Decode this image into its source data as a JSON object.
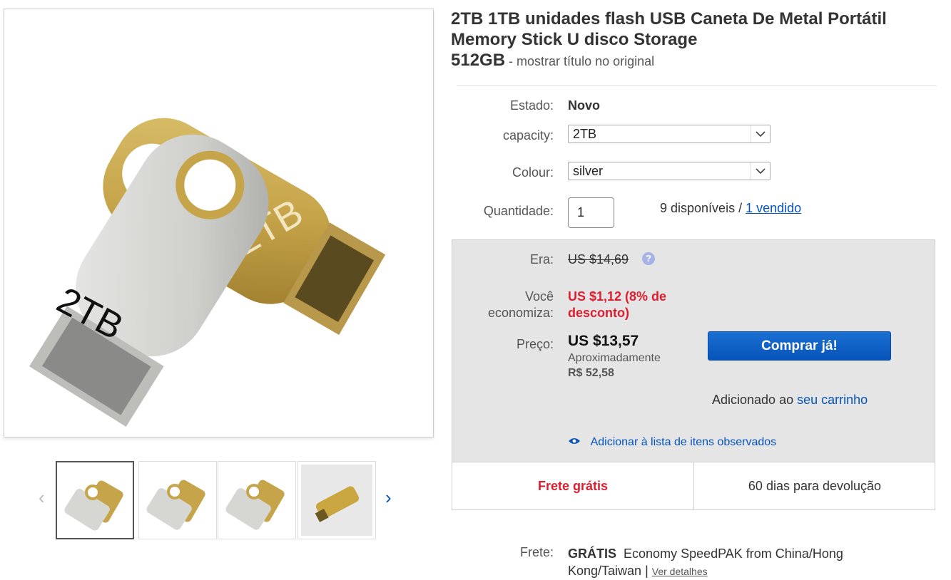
{
  "listing": {
    "title_line1": "2TB 1TB unidades flash USB Caneta De Metal Portátil",
    "title_line2": "Memory Stick U disco Storage",
    "title_line3": "512GB",
    "title_sep": " - ",
    "show_original": "mostrar título no original"
  },
  "product_image": {
    "label_front": "2TB",
    "label_back": "2TB"
  },
  "thumbs": {
    "prev": "‹",
    "next": "›"
  },
  "details": {
    "condition_label": "Estado:",
    "condition_value": "Novo",
    "capacity_label": "capacity:",
    "capacity_value": "2TB",
    "colour_label": "Colour:",
    "colour_value": "silver",
    "quantity_label": "Quantidade:",
    "quantity_value": "1",
    "available": "9 disponíveis /",
    "sold_link": "1 vendido"
  },
  "pricing": {
    "was_label": "Era:",
    "was_value": "US $14,69",
    "save_label_1": "Você",
    "save_label_2": "economiza:",
    "save_value_1": "US $1,12 (8% de",
    "save_value_2": "desconto)",
    "price_label": "Preço:",
    "price_value": "US $13,57",
    "approx_label": "Aproximadamente",
    "approx_value": "R$ 52,58",
    "buy_now": "Comprar já!",
    "added_text": "Adicionado ao",
    "cart_link": "seu carrinho",
    "watch_link": "Adicionar à lista de itens observados",
    "free_shipping": "Frete grátis",
    "returns": "60 dias para devolução",
    "accent_red": "#dd1e31",
    "accent_blue": "#0654ba"
  },
  "shipping": {
    "label": "Frete:",
    "value_bold": "GRÁTIS",
    "service_1": "Economy SpeedPAK from China/Hong",
    "service_2": "Kong/Taiwan |",
    "details_link": "Ver detalhes"
  }
}
